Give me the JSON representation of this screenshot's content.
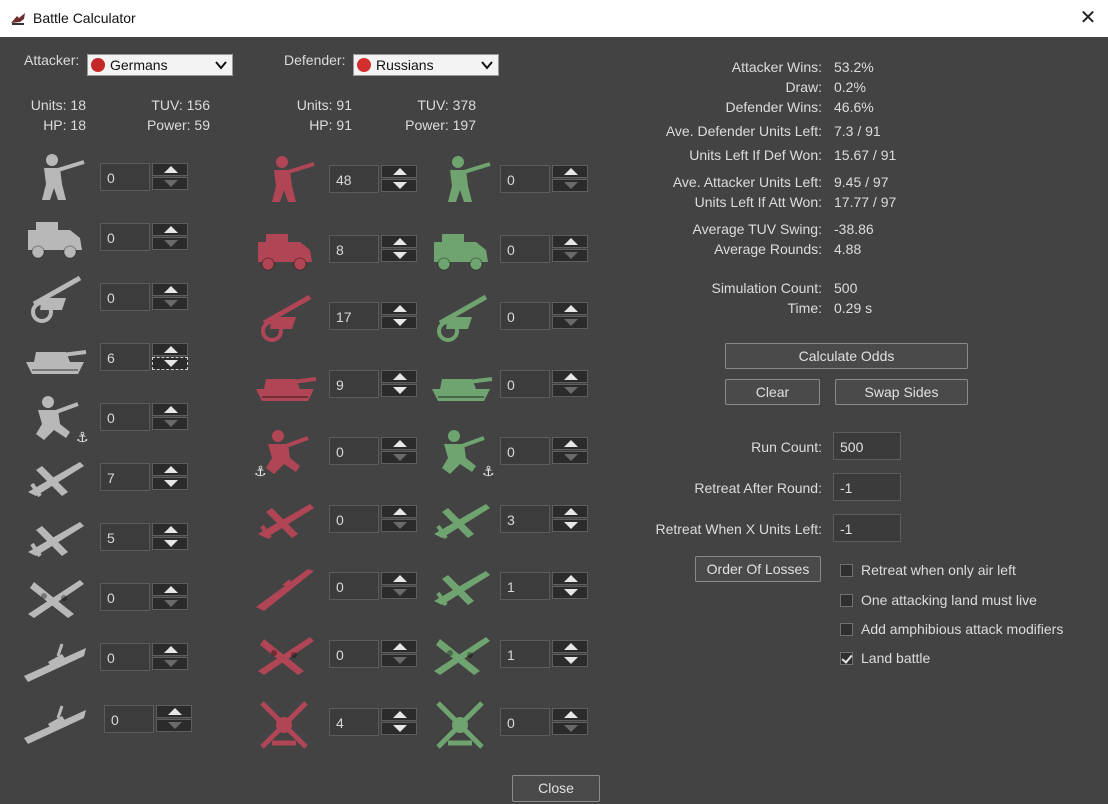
{
  "window": {
    "title": "Battle Calculator",
    "close_glyph": "✕"
  },
  "attacker": {
    "label": "Attacker:",
    "nation": "Germans",
    "stats": {
      "units": "Units: 18",
      "tuv": "TUV: 156",
      "hp": "HP: 18",
      "power": "Power: 59"
    },
    "units": [
      {
        "name": "infantry",
        "value": "0"
      },
      {
        "name": "mech-infantry",
        "value": "0"
      },
      {
        "name": "artillery",
        "value": "0"
      },
      {
        "name": "tank",
        "value": "6"
      },
      {
        "name": "marine",
        "value": "0"
      },
      {
        "name": "fighter",
        "value": "7"
      },
      {
        "name": "tactical-bomber",
        "value": "5"
      },
      {
        "name": "bomber",
        "value": "0"
      },
      {
        "name": "cruiser",
        "value": "0"
      },
      {
        "name": "battleship",
        "value": "0"
      }
    ]
  },
  "defender": {
    "label": "Defender:",
    "nation": "Russians",
    "stats": {
      "units": "Units: 91",
      "tuv": "TUV: 378",
      "hp": "HP: 91",
      "power": "Power: 197"
    },
    "units_col1": [
      {
        "name": "infantry",
        "value": "48"
      },
      {
        "name": "truck",
        "value": "8"
      },
      {
        "name": "artillery",
        "value": "17"
      },
      {
        "name": "tank",
        "value": "9"
      },
      {
        "name": "marine",
        "value": "0"
      },
      {
        "name": "fighter",
        "value": "0"
      },
      {
        "name": "submarine",
        "value": "0"
      },
      {
        "name": "bomber",
        "value": "0"
      },
      {
        "name": "aa-gun",
        "value": "4"
      }
    ],
    "units_col2": [
      {
        "name": "infantry",
        "value": "0"
      },
      {
        "name": "armored-car",
        "value": "0"
      },
      {
        "name": "artillery",
        "value": "0"
      },
      {
        "name": "tank",
        "value": "0"
      },
      {
        "name": "marine",
        "value": "0"
      },
      {
        "name": "fighter",
        "value": "3"
      },
      {
        "name": "fighter-2",
        "value": "1"
      },
      {
        "name": "bomber",
        "value": "1"
      },
      {
        "name": "aa-gun",
        "value": "0"
      }
    ]
  },
  "results": [
    {
      "label": "Attacker Wins:",
      "value": "53.2%"
    },
    {
      "label": "Draw:",
      "value": "0.2%"
    },
    {
      "label": "Defender Wins:",
      "value": "46.6%"
    },
    {
      "label": "Ave. Defender Units Left:",
      "value": "7.3 / 91"
    },
    {
      "label": "Units Left If Def Won:",
      "value": "15.67 / 91"
    },
    {
      "label": "Ave. Attacker Units Left:",
      "value": "9.45 / 97"
    },
    {
      "label": "Units Left If Att Won:",
      "value": "17.77 / 97"
    },
    {
      "label": "Average TUV Swing:",
      "value": "-38.86"
    },
    {
      "label": "Average Rounds:",
      "value": "4.88"
    },
    {
      "label": "Simulation Count:",
      "value": "500"
    },
    {
      "label": "Time:",
      "value": "0.29 s"
    }
  ],
  "buttons": {
    "calculate": "Calculate Odds",
    "clear": "Clear",
    "swap": "Swap Sides",
    "order": "Order Of Losses",
    "close": "Close"
  },
  "settings": {
    "run_count": {
      "label": "Run Count:",
      "value": "500"
    },
    "retreat_round": {
      "label": "Retreat After Round:",
      "value": "-1"
    },
    "retreat_units": {
      "label": "Retreat When X Units Left:",
      "value": "-1"
    }
  },
  "checkboxes": [
    {
      "label": "Retreat when only air left",
      "checked": false
    },
    {
      "label": "One attacking land must live",
      "checked": false
    },
    {
      "label": "Add amphibious attack modifiers",
      "checked": false
    },
    {
      "label": "Land battle",
      "checked": true
    }
  ],
  "colors": {
    "german": "#b8b8b8",
    "russian": "#b04555",
    "ally": "#6fa36f",
    "flag_german": "#c62828",
    "flag_russian": "#d32f2f"
  }
}
